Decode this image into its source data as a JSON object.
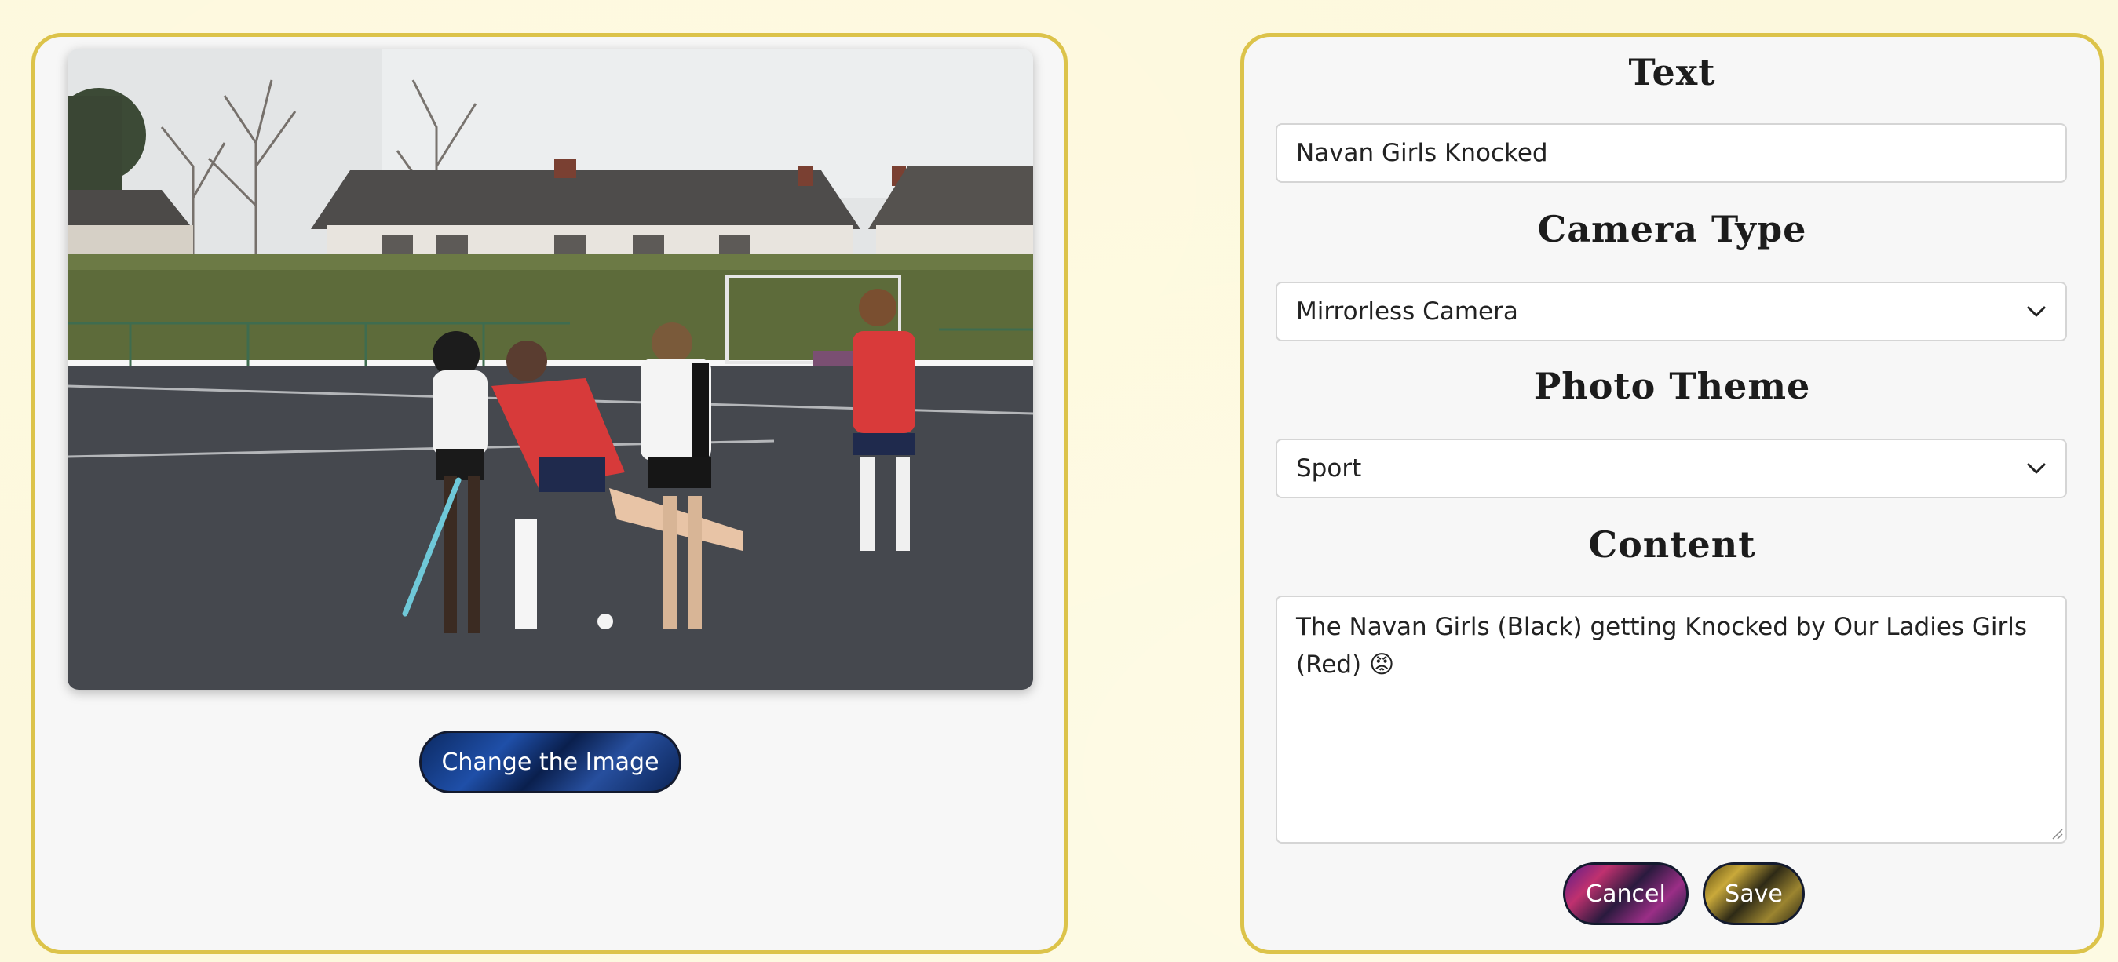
{
  "left_panel": {
    "change_image_label": "Change the Image"
  },
  "form": {
    "text_title": "Text",
    "text_value": "Navan Girls Knocked",
    "camera_title": "Camera Type",
    "camera_value": "Mirrorless Camera",
    "theme_title": "Photo Theme",
    "theme_value": "Sport",
    "content_title": "Content",
    "content_value": "The Navan Girls (Black) getting Knocked by Our Ladies Girls (Red) 😡",
    "cancel_label": "Cancel",
    "save_label": "Save"
  },
  "colors": {
    "page_background": "#fcf8dd",
    "panel_border": "#dcc34a",
    "panel_background": "#f7f7f7"
  },
  "icons": {
    "select_arrow": "chevron-down-icon"
  }
}
